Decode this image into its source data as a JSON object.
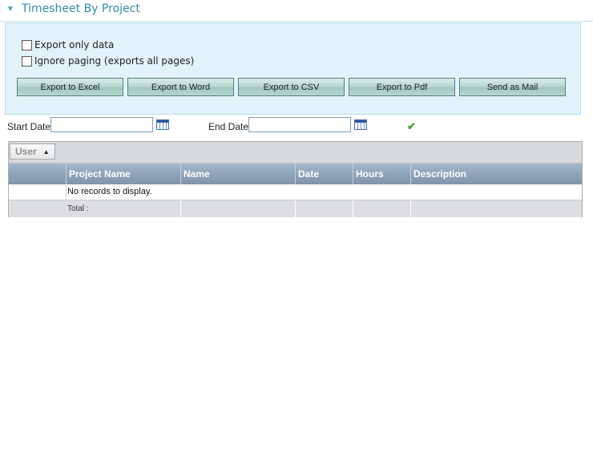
{
  "header": {
    "title": "Timesheet By Project",
    "collapse_icon": "triangle-down"
  },
  "export_options": {
    "export_only_data": {
      "label": "Export only data",
      "checked": false
    },
    "ignore_paging": {
      "label": "Ignore paging (exports all pages)",
      "checked": false
    }
  },
  "export_buttons": [
    "Export to Excel",
    "Export to Word",
    "Export to CSV",
    "Export to Pdf",
    "Send as Mail"
  ],
  "filters": {
    "start_date": {
      "label": "Start Date",
      "value": ""
    },
    "end_date": {
      "label": "End Date",
      "value": ""
    },
    "apply_icon": "check"
  },
  "grid": {
    "group_by": {
      "label": "User",
      "sort": "ascending"
    },
    "columns": [
      "",
      "Project Name",
      "Name",
      "Date",
      "Hours",
      "Description"
    ],
    "empty_message": "No records to display.",
    "footer_label": "Total :"
  },
  "colors": {
    "title": "#2f8ea8",
    "panel_bg": "#e2f3fb",
    "header_bg": "#8ea4b9",
    "apply_check": "#44a336"
  }
}
